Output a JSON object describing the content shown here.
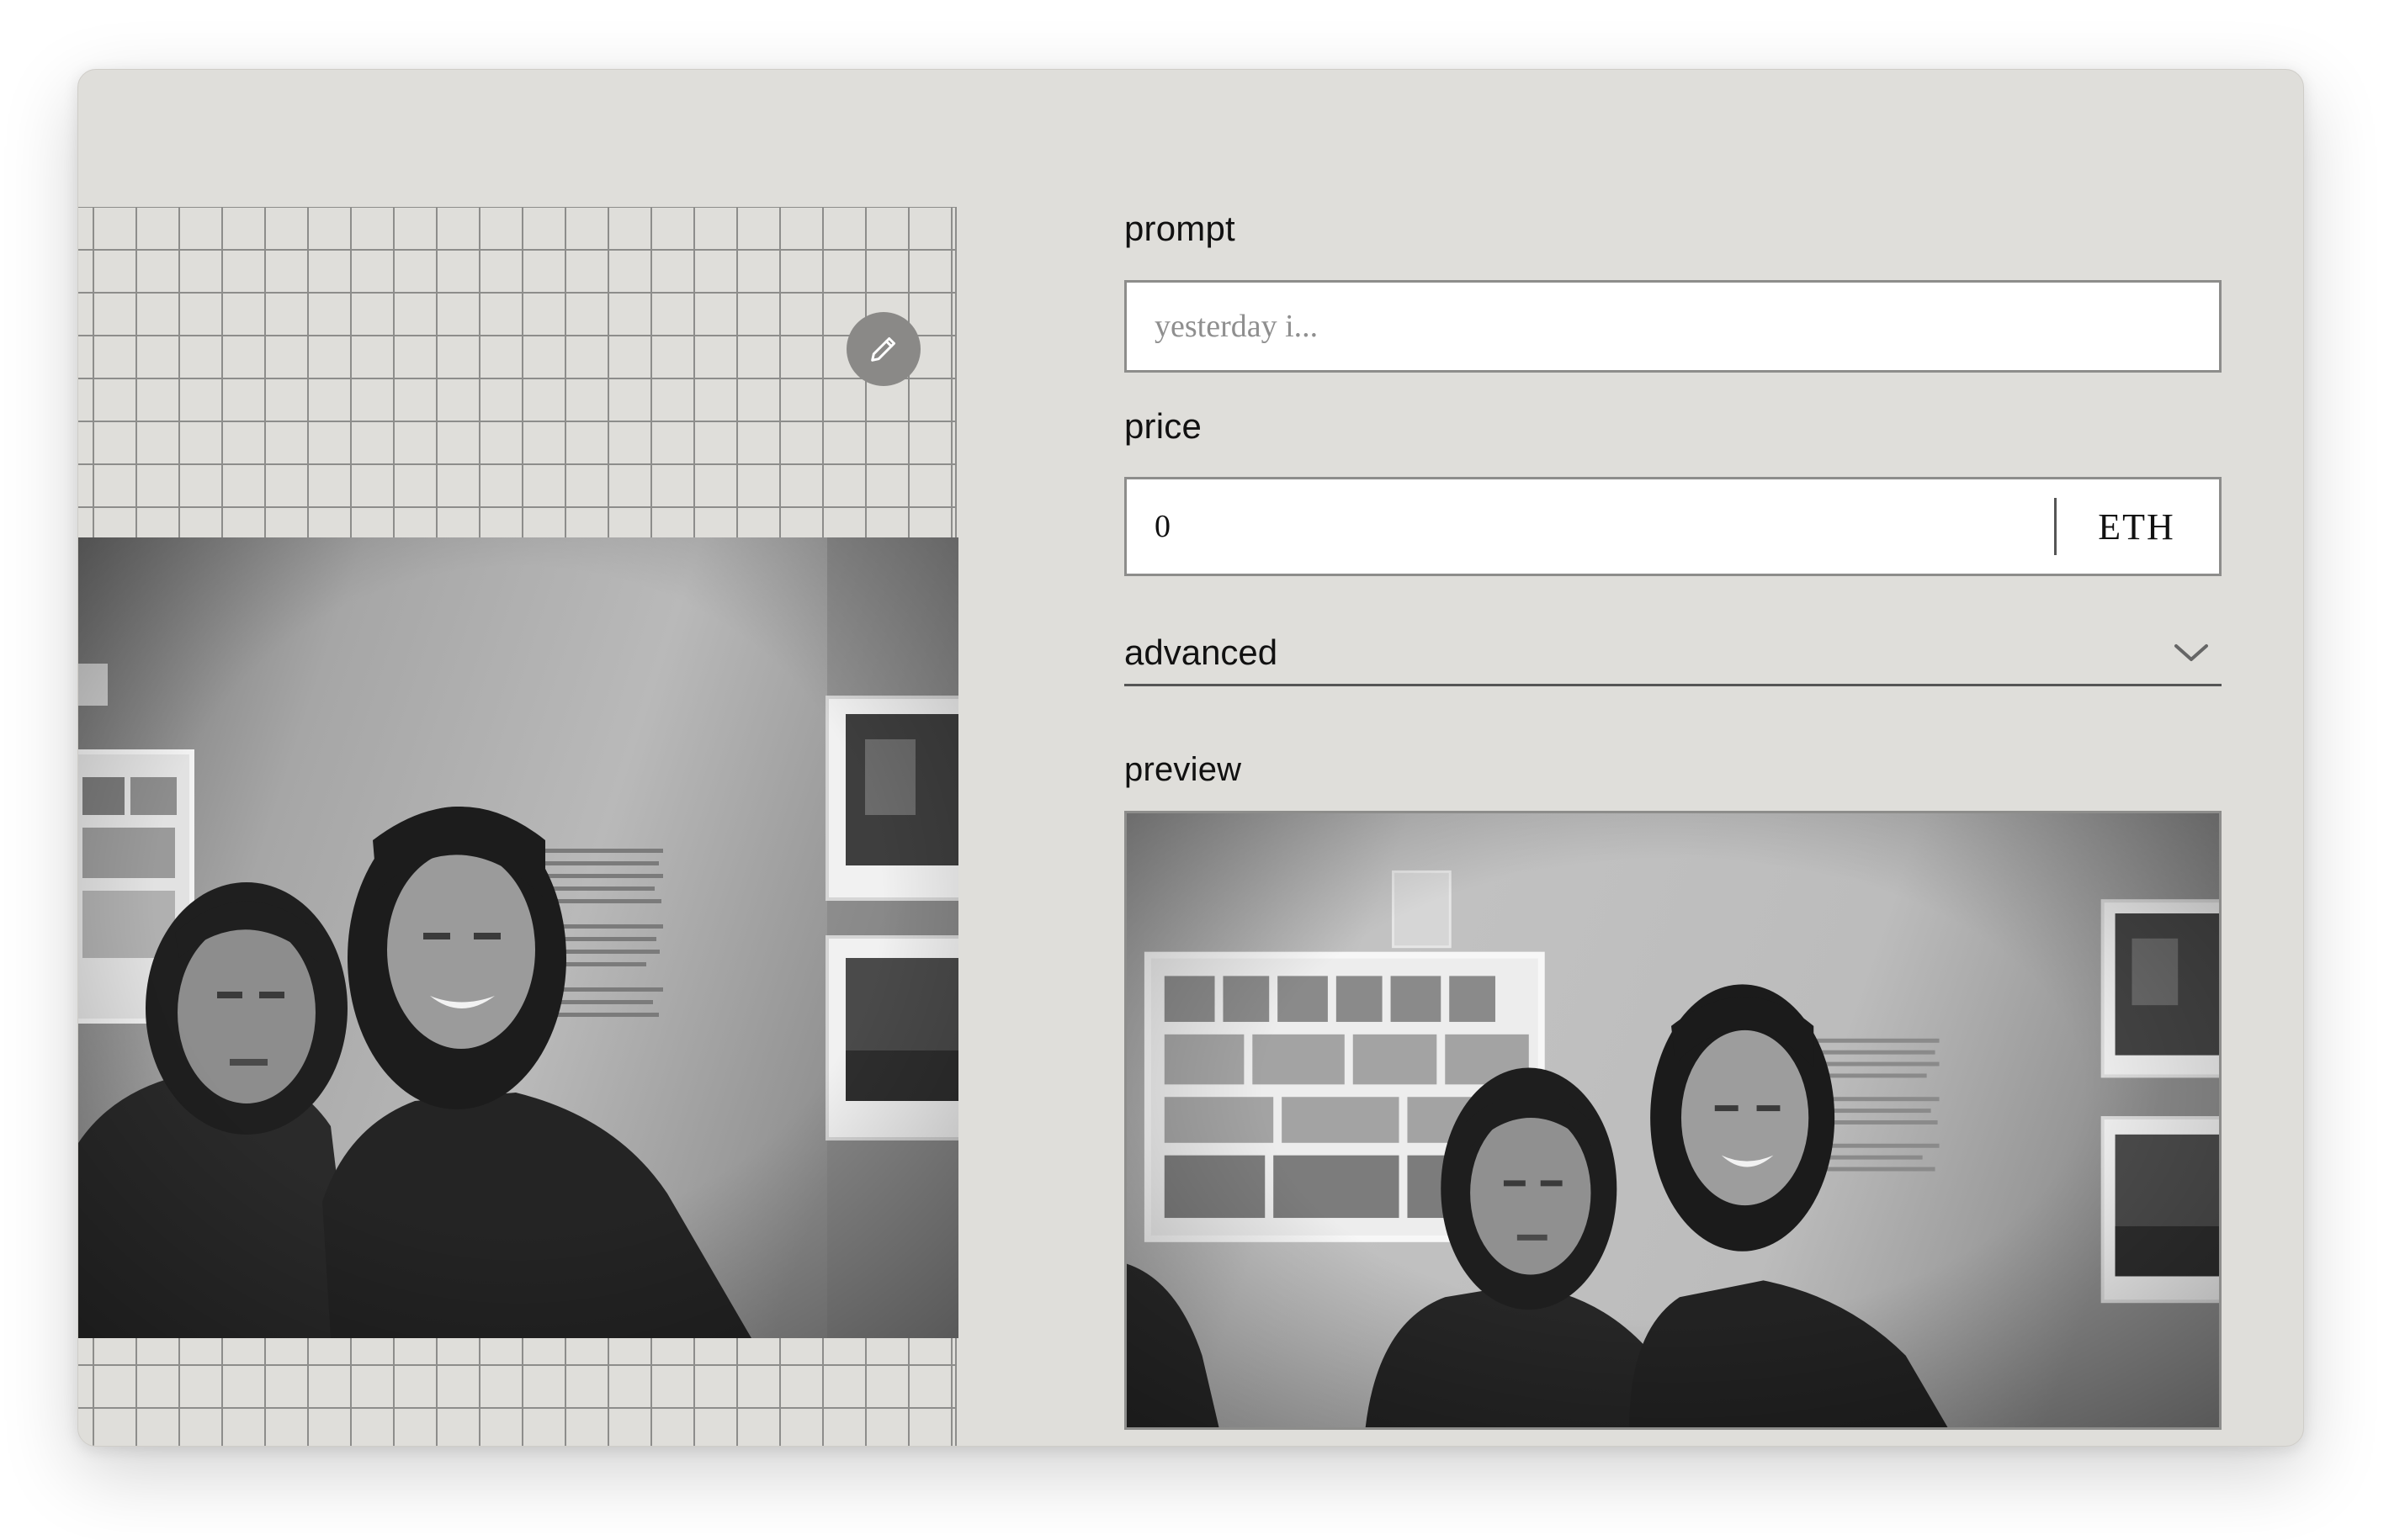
{
  "form": {
    "prompt_label": "prompt",
    "prompt_value": "",
    "prompt_placeholder": "yesterday i...",
    "price_label": "price",
    "price_value": "0",
    "currency": "ETH",
    "advanced_label": "advanced",
    "preview_label": "preview"
  },
  "icons": {
    "edit": "pencil-icon",
    "expand": "chevron-down-icon"
  },
  "colors": {
    "window_bg": "#dfdeda",
    "grid_line": "#8d8d8b",
    "edit_button": "#8a8987"
  }
}
